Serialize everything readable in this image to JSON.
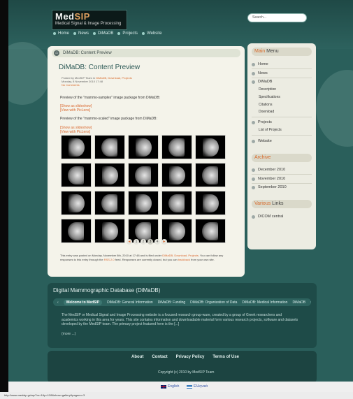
{
  "site": {
    "logo_main": "MedSIP",
    "logo_sub": "Medical Signal & Image Processing"
  },
  "search": {
    "placeholder": "Search..."
  },
  "topnav": [
    "Home",
    "News",
    "DiMaDB",
    "Projects",
    "Website"
  ],
  "breadcrumb": {
    "text": "DiMaDB: Content Preview"
  },
  "post": {
    "title": "DiMaDB: Content Preview",
    "meta_posted": "Posted by MedSIP Team in",
    "meta_cats": "DiMaDB, Download, Projects",
    "meta_date": "Monday, 8 November 2010 17:48",
    "meta_comments": "No Comments",
    "intro1": "Preview of the \"mammo-samples\" image package from DiMaDB:",
    "link_slideshow": "[Show as slideshow]",
    "link_piclens": "[View with PicLens]",
    "intro2": "Preview of the \"mammo-scaled\" image package from DiMaDB:",
    "pager": [
      "◄",
      "1",
      "2",
      "3",
      "4",
      "►"
    ],
    "footer_a": "This entry was posted on Monday, November 8th, 2010 at 17:48 and is filed under",
    "footer_cats": "DiMaDB, Download, Projects",
    "footer_b": ". You can follow any responses to this entry through the",
    "footer_rss": "RSS 2.0",
    "footer_c": "feed. Responses are currently closed, but you can",
    "footer_tb": "trackback",
    "footer_d": "from your own site."
  },
  "sidebar": {
    "menu_title_a": "Main",
    "menu_title_b": "Menu",
    "menu": [
      "Home",
      "News",
      "DiMaDB",
      "Projects",
      "Website"
    ],
    "dimadb_sub": [
      "Description",
      "Specifications",
      "Citations",
      "Download"
    ],
    "projects_sub": [
      "List of Projects"
    ],
    "archive_title": "Archive",
    "archive": [
      "December 2010",
      "November 2010",
      "September 2010"
    ],
    "links_title_a": "Various",
    "links_title_b": "Links",
    "links": [
      "DICOM central"
    ]
  },
  "dimadb_box": {
    "title": "Digital Mammographic Database (DiMaDB)",
    "tabs": [
      "Welcome to MedSIP",
      "DiMaDB: General Information",
      "DiMaDB: Funding",
      "DiMaDB: Organization of Data",
      "DiMaDB: Medical Information",
      "DiMaDB"
    ],
    "text": "The MedSIP or Medical Signal and Image Processing website is a focused research group-ware, created by a group of Greek researchers and academics working in this area for years. This site contains information and downloadable material form various research projects, software and datasets developed by the MedSIP team. The primary project featured here is the [...]",
    "more": "(more ...)"
  },
  "bottom": {
    "nav": [
      "About",
      "Contact",
      "Privacy Policy",
      "Terms of Use"
    ],
    "copyright": "Copyright (c) 2010 by MedSIP Team"
  },
  "languages": [
    "English",
    "Ελληνικά"
  ],
  "status_url": "http://www.medsip.gr/wp/?m=1&p=128&show=gallery&pageno=3"
}
